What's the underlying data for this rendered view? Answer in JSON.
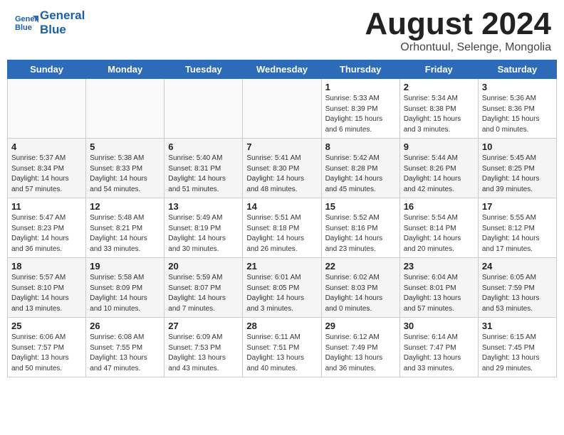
{
  "header": {
    "logo_line1": "General",
    "logo_line2": "Blue",
    "month": "August 2024",
    "location": "Orhontuul, Selenge, Mongolia"
  },
  "weekdays": [
    "Sunday",
    "Monday",
    "Tuesday",
    "Wednesday",
    "Thursday",
    "Friday",
    "Saturday"
  ],
  "weeks": [
    [
      {
        "day": "",
        "info": ""
      },
      {
        "day": "",
        "info": ""
      },
      {
        "day": "",
        "info": ""
      },
      {
        "day": "",
        "info": ""
      },
      {
        "day": "1",
        "info": "Sunrise: 5:33 AM\nSunset: 8:39 PM\nDaylight: 15 hours\nand 6 minutes."
      },
      {
        "day": "2",
        "info": "Sunrise: 5:34 AM\nSunset: 8:38 PM\nDaylight: 15 hours\nand 3 minutes."
      },
      {
        "day": "3",
        "info": "Sunrise: 5:36 AM\nSunset: 8:36 PM\nDaylight: 15 hours\nand 0 minutes."
      }
    ],
    [
      {
        "day": "4",
        "info": "Sunrise: 5:37 AM\nSunset: 8:34 PM\nDaylight: 14 hours\nand 57 minutes."
      },
      {
        "day": "5",
        "info": "Sunrise: 5:38 AM\nSunset: 8:33 PM\nDaylight: 14 hours\nand 54 minutes."
      },
      {
        "day": "6",
        "info": "Sunrise: 5:40 AM\nSunset: 8:31 PM\nDaylight: 14 hours\nand 51 minutes."
      },
      {
        "day": "7",
        "info": "Sunrise: 5:41 AM\nSunset: 8:30 PM\nDaylight: 14 hours\nand 48 minutes."
      },
      {
        "day": "8",
        "info": "Sunrise: 5:42 AM\nSunset: 8:28 PM\nDaylight: 14 hours\nand 45 minutes."
      },
      {
        "day": "9",
        "info": "Sunrise: 5:44 AM\nSunset: 8:26 PM\nDaylight: 14 hours\nand 42 minutes."
      },
      {
        "day": "10",
        "info": "Sunrise: 5:45 AM\nSunset: 8:25 PM\nDaylight: 14 hours\nand 39 minutes."
      }
    ],
    [
      {
        "day": "11",
        "info": "Sunrise: 5:47 AM\nSunset: 8:23 PM\nDaylight: 14 hours\nand 36 minutes."
      },
      {
        "day": "12",
        "info": "Sunrise: 5:48 AM\nSunset: 8:21 PM\nDaylight: 14 hours\nand 33 minutes."
      },
      {
        "day": "13",
        "info": "Sunrise: 5:49 AM\nSunset: 8:19 PM\nDaylight: 14 hours\nand 30 minutes."
      },
      {
        "day": "14",
        "info": "Sunrise: 5:51 AM\nSunset: 8:18 PM\nDaylight: 14 hours\nand 26 minutes."
      },
      {
        "day": "15",
        "info": "Sunrise: 5:52 AM\nSunset: 8:16 PM\nDaylight: 14 hours\nand 23 minutes."
      },
      {
        "day": "16",
        "info": "Sunrise: 5:54 AM\nSunset: 8:14 PM\nDaylight: 14 hours\nand 20 minutes."
      },
      {
        "day": "17",
        "info": "Sunrise: 5:55 AM\nSunset: 8:12 PM\nDaylight: 14 hours\nand 17 minutes."
      }
    ],
    [
      {
        "day": "18",
        "info": "Sunrise: 5:57 AM\nSunset: 8:10 PM\nDaylight: 14 hours\nand 13 minutes."
      },
      {
        "day": "19",
        "info": "Sunrise: 5:58 AM\nSunset: 8:09 PM\nDaylight: 14 hours\nand 10 minutes."
      },
      {
        "day": "20",
        "info": "Sunrise: 5:59 AM\nSunset: 8:07 PM\nDaylight: 14 hours\nand 7 minutes."
      },
      {
        "day": "21",
        "info": "Sunrise: 6:01 AM\nSunset: 8:05 PM\nDaylight: 14 hours\nand 3 minutes."
      },
      {
        "day": "22",
        "info": "Sunrise: 6:02 AM\nSunset: 8:03 PM\nDaylight: 14 hours\nand 0 minutes."
      },
      {
        "day": "23",
        "info": "Sunrise: 6:04 AM\nSunset: 8:01 PM\nDaylight: 13 hours\nand 57 minutes."
      },
      {
        "day": "24",
        "info": "Sunrise: 6:05 AM\nSunset: 7:59 PM\nDaylight: 13 hours\nand 53 minutes."
      }
    ],
    [
      {
        "day": "25",
        "info": "Sunrise: 6:06 AM\nSunset: 7:57 PM\nDaylight: 13 hours\nand 50 minutes."
      },
      {
        "day": "26",
        "info": "Sunrise: 6:08 AM\nSunset: 7:55 PM\nDaylight: 13 hours\nand 47 minutes."
      },
      {
        "day": "27",
        "info": "Sunrise: 6:09 AM\nSunset: 7:53 PM\nDaylight: 13 hours\nand 43 minutes."
      },
      {
        "day": "28",
        "info": "Sunrise: 6:11 AM\nSunset: 7:51 PM\nDaylight: 13 hours\nand 40 minutes."
      },
      {
        "day": "29",
        "info": "Sunrise: 6:12 AM\nSunset: 7:49 PM\nDaylight: 13 hours\nand 36 minutes."
      },
      {
        "day": "30",
        "info": "Sunrise: 6:14 AM\nSunset: 7:47 PM\nDaylight: 13 hours\nand 33 minutes."
      },
      {
        "day": "31",
        "info": "Sunrise: 6:15 AM\nSunset: 7:45 PM\nDaylight: 13 hours\nand 29 minutes."
      }
    ]
  ]
}
